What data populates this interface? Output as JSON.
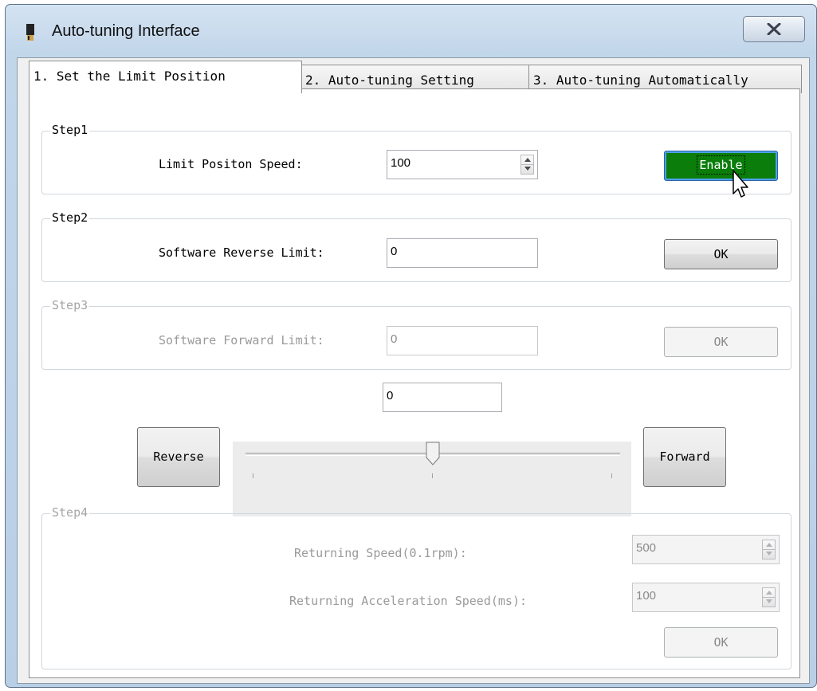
{
  "window": {
    "title": "Auto-tuning Interface"
  },
  "tabs": [
    {
      "label": "1. Set the Limit Position"
    },
    {
      "label": "2. Auto-tuning Setting"
    },
    {
      "label": "3. Auto-tuning Automatically"
    }
  ],
  "step1": {
    "title": "Step1",
    "speed_label": "Limit Positon Speed:",
    "speed_value": "100",
    "enable_button": "Enable"
  },
  "step2": {
    "title": "Step2",
    "reverse_limit_label": "Software Reverse Limit:",
    "reverse_limit_value": "0",
    "ok_button": "OK"
  },
  "step3": {
    "title": "Step3",
    "forward_limit_label": "Software Forward Limit:",
    "forward_limit_value": "0",
    "ok_button": "OK"
  },
  "jog": {
    "position_value": "0",
    "reverse_button": "Reverse",
    "forward_button": "Forward",
    "slider_fraction": 0.5
  },
  "step4": {
    "title": "Step4",
    "returning_speed_label": "Returning Speed(0.1rpm):",
    "returning_speed_value": "500",
    "returning_accel_label": "Returning Acceleration Speed(ms):",
    "returning_accel_value": "100",
    "ok_button": "OK"
  },
  "colors": {
    "enable_button_bg": "#0a7d0a",
    "disabled_text": "#9a9a9a"
  }
}
